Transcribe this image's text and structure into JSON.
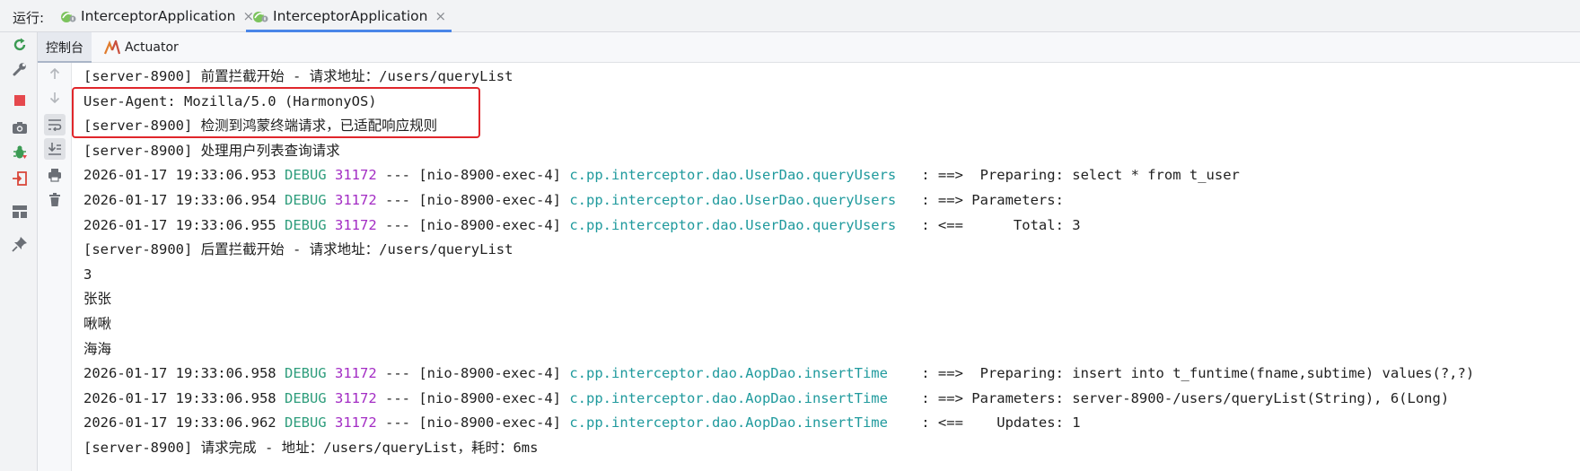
{
  "run_panel": {
    "label": "运行:",
    "tabs": [
      {
        "label": "InterceptorApplication",
        "close": "×",
        "active": false
      },
      {
        "label": "InterceptorApplication",
        "close": "×",
        "active": true
      }
    ]
  },
  "left_toolbar": {
    "buttons": [
      "rerun-icon",
      "settings-wrench-icon",
      "stop-icon",
      "screenshot-camera-icon",
      "debug-bug-icon",
      "exit-icon",
      "layout-icon",
      "pin-icon"
    ]
  },
  "sub_tabs": [
    {
      "label": "控制台",
      "active": true
    },
    {
      "label": "Actuator",
      "active": false
    }
  ],
  "console_gutter": {
    "buttons": [
      "scroll-up-icon",
      "scroll-down-icon",
      "soft-wrap-icon",
      "scroll-to-end-icon",
      "print-icon",
      "clear-trash-icon"
    ]
  },
  "colors": {
    "debug": "#2e9d7c",
    "pid": "#a32cc4",
    "logger": "#1f9a9d",
    "highlight": "#e0262b",
    "accent": "#4a86e8"
  },
  "console": {
    "lines": [
      {
        "text": "[server-8900] 前置拦截开始 - 请求地址：/users/queryList"
      },
      {
        "text": "User-Agent: Mozilla/5.0 (HarmonyOS)"
      },
      {
        "text": "[server-8900] 检测到鸿蒙终端请求，已适配响应规则"
      },
      {
        "text": "[server-8900] 处理用户列表查询请求"
      },
      {
        "time": "2026-01-17 19:33:06.953",
        "level": "DEBUG",
        "pid": "31172",
        "thread": "--- [nio-8900-exec-4]",
        "logger": "c.pp.interceptor.dao.UserDao.queryUsers  ",
        "msg": " : ==>  Preparing: select * from t_user"
      },
      {
        "time": "2026-01-17 19:33:06.954",
        "level": "DEBUG",
        "pid": "31172",
        "thread": "--- [nio-8900-exec-4]",
        "logger": "c.pp.interceptor.dao.UserDao.queryUsers  ",
        "msg": " : ==> Parameters: "
      },
      {
        "time": "2026-01-17 19:33:06.955",
        "level": "DEBUG",
        "pid": "31172",
        "thread": "--- [nio-8900-exec-4]",
        "logger": "c.pp.interceptor.dao.UserDao.queryUsers  ",
        "msg": " : <==      Total: 3"
      },
      {
        "text": "[server-8900] 后置拦截开始 - 请求地址：/users/queryList"
      },
      {
        "text": "3"
      },
      {
        "text": "张张"
      },
      {
        "text": "啾啾"
      },
      {
        "text": "海海"
      },
      {
        "time": "2026-01-17 19:33:06.958",
        "level": "DEBUG",
        "pid": "31172",
        "thread": "--- [nio-8900-exec-4]",
        "logger": "c.pp.interceptor.dao.AopDao.insertTime   ",
        "msg": " : ==>  Preparing: insert into t_funtime(fname,subtime) values(?,?)"
      },
      {
        "time": "2026-01-17 19:33:06.958",
        "level": "DEBUG",
        "pid": "31172",
        "thread": "--- [nio-8900-exec-4]",
        "logger": "c.pp.interceptor.dao.AopDao.insertTime   ",
        "msg": " : ==> Parameters: server-8900-/users/queryList(String), 6(Long)"
      },
      {
        "time": "2026-01-17 19:33:06.962",
        "level": "DEBUG",
        "pid": "31172",
        "thread": "--- [nio-8900-exec-4]",
        "logger": "c.pp.interceptor.dao.AopDao.insertTime   ",
        "msg": " : <==    Updates: 1"
      },
      {
        "text": "[server-8900] 请求完成 - 地址：/users/queryList，耗时：6ms"
      }
    ]
  }
}
